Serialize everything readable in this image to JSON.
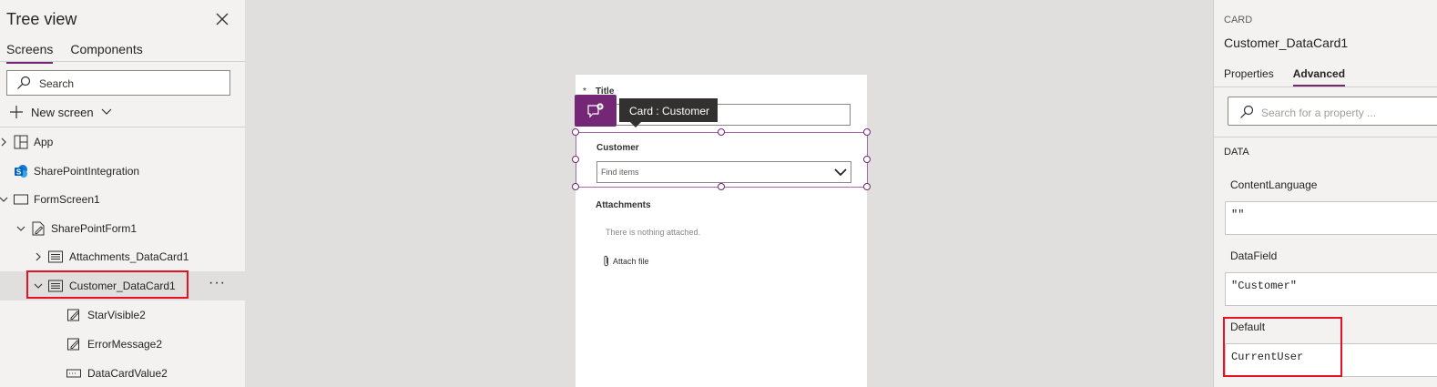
{
  "tree": {
    "title": "Tree view",
    "tabs": [
      "Screens",
      "Components"
    ],
    "search_placeholder": "Search",
    "new_screen": "New screen",
    "nodes": [
      {
        "label": "App",
        "icon": "app-icon"
      },
      {
        "label": "SharePointIntegration",
        "icon": "sharepoint-icon"
      },
      {
        "label": "FormScreen1",
        "icon": "screen-icon"
      },
      {
        "label": "SharePointForm1",
        "icon": "form-icon"
      },
      {
        "label": "Attachments_DataCard1",
        "icon": "datacard-icon"
      },
      {
        "label": "Customer_DataCard1",
        "icon": "datacard-icon",
        "selected": true
      },
      {
        "label": "StarVisible2",
        "icon": "edit-label-icon"
      },
      {
        "label": "ErrorMessage2",
        "icon": "edit-label-icon"
      },
      {
        "label": "DataCardValue2",
        "icon": "combobox-icon"
      }
    ]
  },
  "canvas": {
    "form": {
      "star": "*",
      "title_label": "Title",
      "tooltip": "Card : Customer",
      "customer_label": "Customer",
      "customer_placeholder": "Find items",
      "attachments_label": "Attachments",
      "attachments_empty": "There is nothing attached.",
      "attach_file": "Attach file"
    }
  },
  "props": {
    "category": "CARD",
    "control_name": "Customer_DataCard1",
    "tabs": [
      "Properties",
      "Advanced"
    ],
    "active_tab": "Advanced",
    "search_placeholder": "Search for a property ...",
    "section": "DATA",
    "fields": [
      {
        "label": "ContentLanguage",
        "value": "\"\""
      },
      {
        "label": "DataField",
        "value": "\"Customer\""
      },
      {
        "label": "Default",
        "value": "CurrentUser"
      }
    ]
  },
  "colors": {
    "accent": "#742774",
    "highlight": "#e81123",
    "selection": "#a768a7"
  }
}
